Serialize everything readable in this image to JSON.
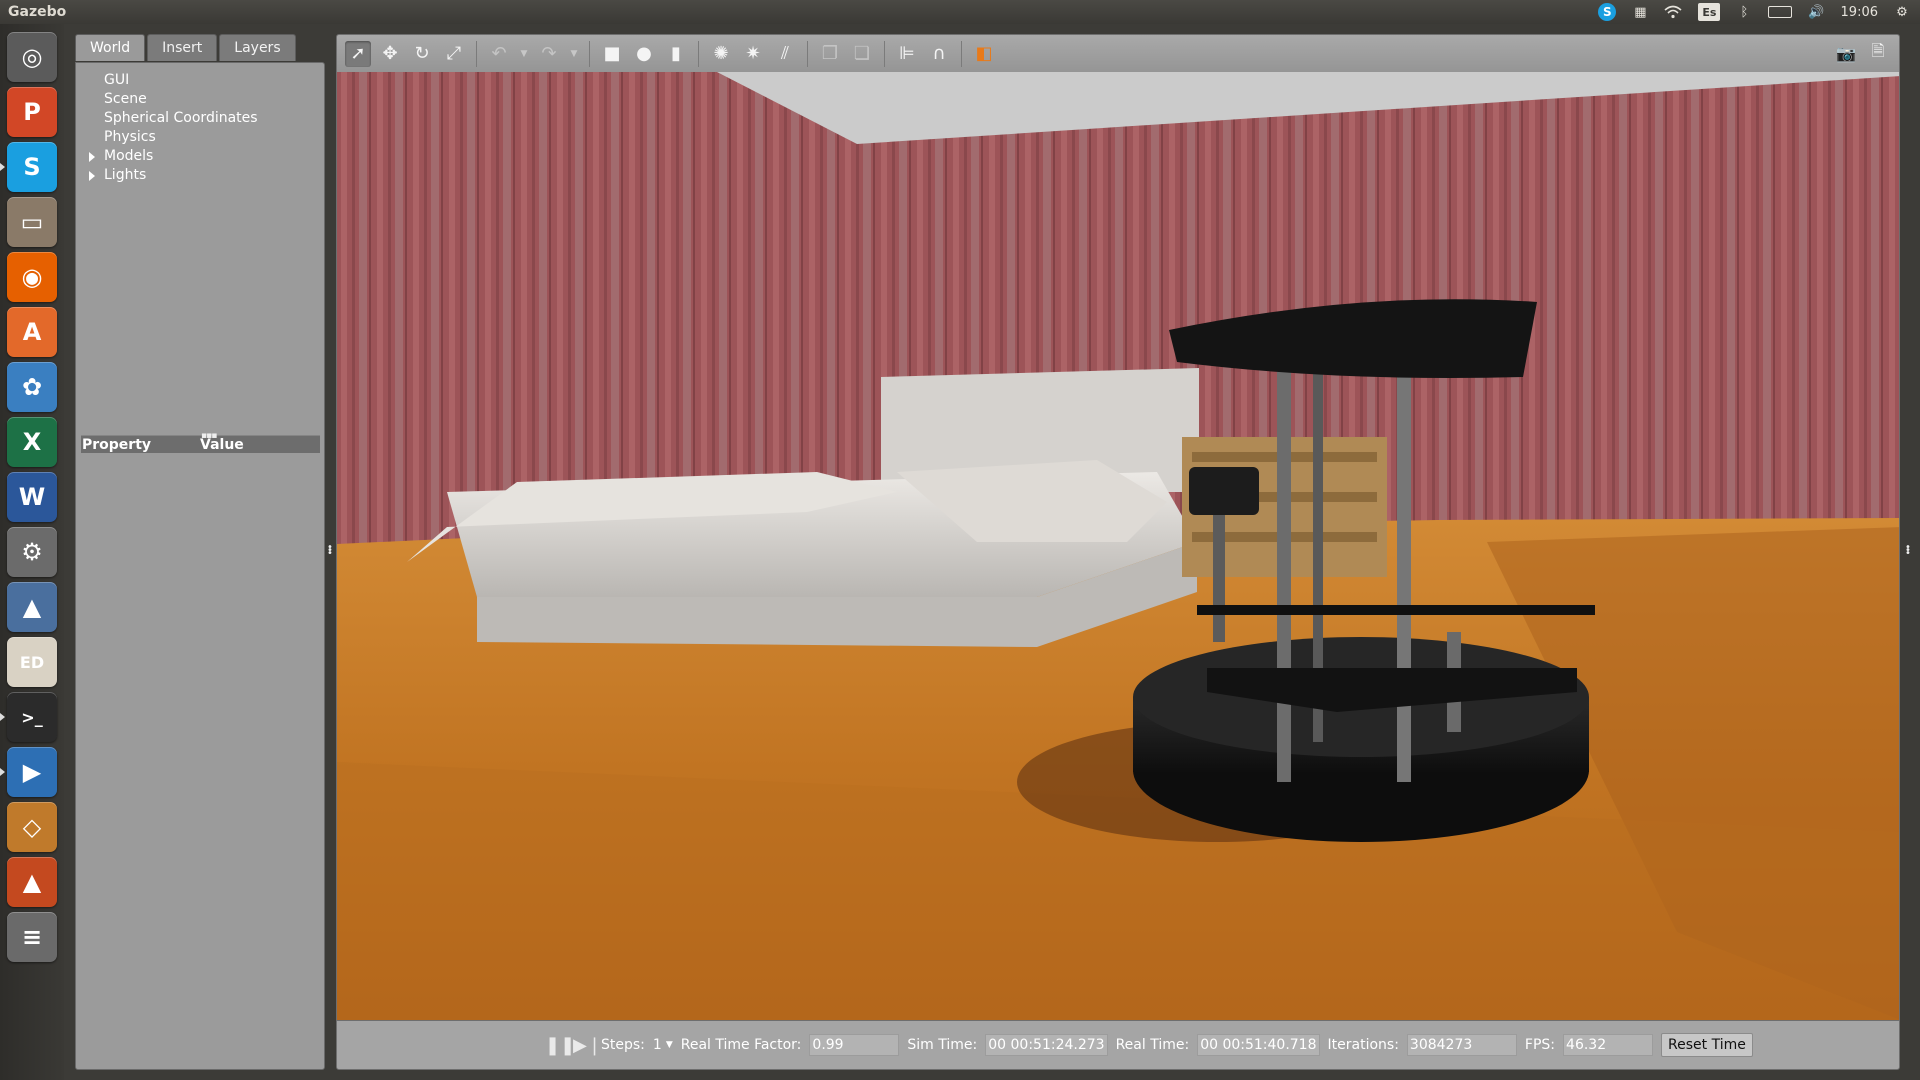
{
  "topbar": {
    "app_title": "Gazebo",
    "keyboard_layout": "Es",
    "clock": "19:06",
    "skype_letter": "S",
    "icons": [
      "skype-icon",
      "workspaces-icon",
      "wifi-icon",
      "keyboard-layout-indicator",
      "bluetooth-icon",
      "battery-icon",
      "volume-icon",
      "clock",
      "settings-gear-icon"
    ]
  },
  "launcher": {
    "items": [
      {
        "name": "ubuntu-dash-icon",
        "glyph": "◎",
        "color": "#5b5b5b"
      },
      {
        "name": "powerpoint-icon",
        "glyph": "P",
        "color": "#d24726"
      },
      {
        "name": "skype-launcher-icon",
        "glyph": "S",
        "color": "#1a9fe0"
      },
      {
        "name": "files-icon",
        "glyph": "▭",
        "color": "#8a7a68"
      },
      {
        "name": "firefox-icon",
        "glyph": "◉",
        "color": "#e66000"
      },
      {
        "name": "software-center-icon",
        "glyph": "A",
        "color": "#e3692a"
      },
      {
        "name": "picasa-icon",
        "glyph": "✿",
        "color": "#3a7fc1"
      },
      {
        "name": "excel-icon",
        "glyph": "X",
        "color": "#1d7146"
      },
      {
        "name": "word-icon",
        "glyph": "W",
        "color": "#2b579a"
      },
      {
        "name": "system-settings-icon",
        "glyph": "⚙",
        "color": "#6b6b6b"
      },
      {
        "name": "matlab-icon",
        "glyph": "▲",
        "color": "#4a6f9e"
      },
      {
        "name": "pdf-editor-icon",
        "glyph": "ED",
        "color": "#d9d2c4"
      },
      {
        "name": "terminal-icon",
        "glyph": ">_",
        "color": "#2b2b2b"
      },
      {
        "name": "media-player-icon",
        "glyph": "▶",
        "color": "#2d6fb4"
      },
      {
        "name": "virtualbox-icon",
        "glyph": "◇",
        "color": "#c07a2b"
      },
      {
        "name": "matlab-2-icon",
        "glyph": "▲",
        "color": "#c4491f"
      },
      {
        "name": "stacked-apps-icon",
        "glyph": "≡",
        "color": "#6a6a6a"
      }
    ]
  },
  "leftpanel": {
    "tabs": [
      {
        "label": "World",
        "active": true
      },
      {
        "label": "Insert",
        "active": false
      },
      {
        "label": "Layers",
        "active": false
      }
    ],
    "tree": [
      {
        "label": "GUI",
        "expandable": false
      },
      {
        "label": "Scene",
        "expandable": false
      },
      {
        "label": "Spherical Coordinates",
        "expandable": false
      },
      {
        "label": "Physics",
        "expandable": false
      },
      {
        "label": "Models",
        "expandable": true
      },
      {
        "label": "Lights",
        "expandable": true
      }
    ],
    "property_header": {
      "property": "Property",
      "value": "Value"
    }
  },
  "toolbar": {
    "tools": [
      "select-mode-icon",
      "translate-mode-icon",
      "rotate-mode-icon",
      "scale-mode-icon",
      "undo-icon",
      "undo-history-icon",
      "redo-icon",
      "redo-history-icon",
      "box-shape-icon",
      "sphere-shape-icon",
      "cylinder-shape-icon",
      "point-light-icon",
      "spot-light-icon",
      "directional-light-icon",
      "copy-icon",
      "paste-icon",
      "align-icon",
      "snap-icon",
      "view-angle-icon",
      "screenshot-icon",
      "log-icon"
    ]
  },
  "timebar": {
    "steps_label": "Steps:",
    "steps_value": "1",
    "rtf_label": "Real Time Factor:",
    "rtf_value": "0.99",
    "sim_time_label": "Sim Time:",
    "sim_time_value": "00 00:51:24.273",
    "real_time_label": "Real Time:",
    "real_time_value": "00 00:51:40.718",
    "iterations_label": "Iterations:",
    "iterations_value": "3084273",
    "fps_label": "FPS:",
    "fps_value": "46.32",
    "reset_label": "Reset Time"
  },
  "scene_colors": {
    "wall": "#9d5458",
    "ceiling": "#c9c9c9",
    "floor": "#c77a28",
    "bed": "#d9d6d2",
    "nightstand": "#b08a55",
    "robot": "#161616"
  }
}
